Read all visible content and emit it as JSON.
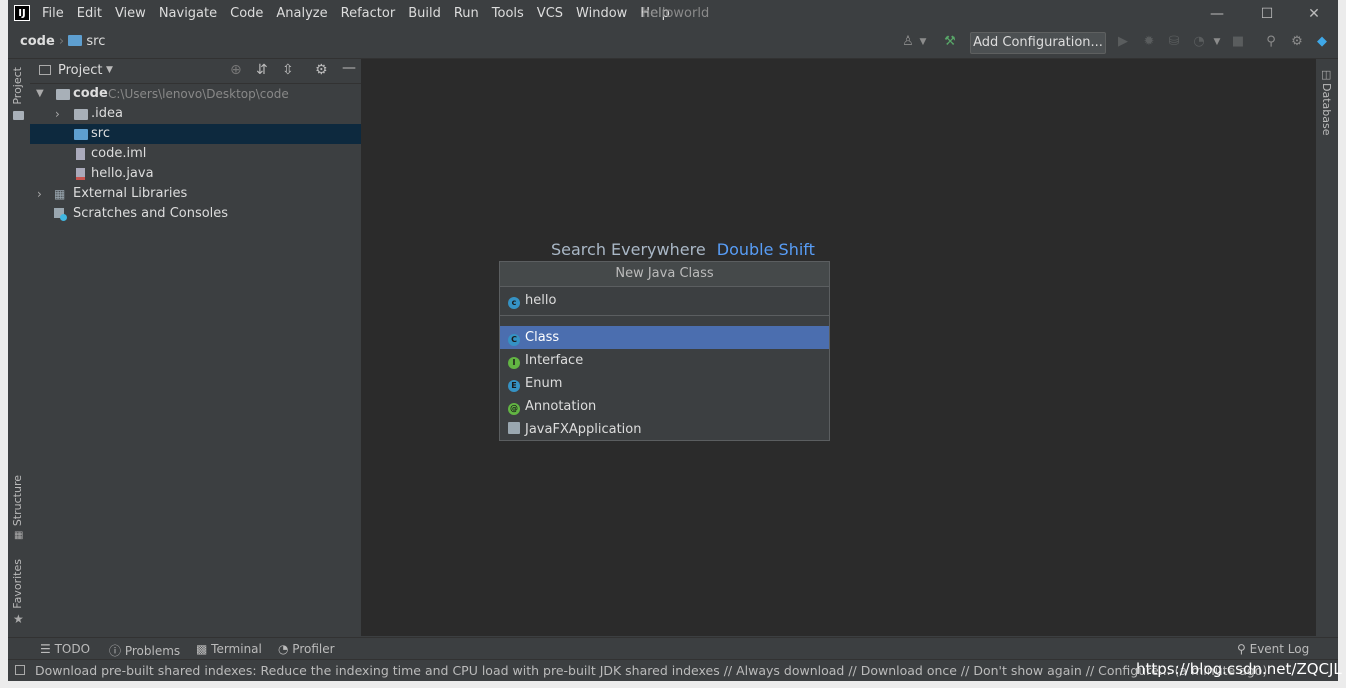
{
  "window": {
    "title": "helloworld",
    "app_logo": "IJ"
  },
  "menu": [
    "File",
    "Edit",
    "View",
    "Navigate",
    "Code",
    "Analyze",
    "Refactor",
    "Build",
    "Run",
    "Tools",
    "VCS",
    "Window",
    "Help"
  ],
  "breadcrumb": {
    "root": "code",
    "child": "src"
  },
  "toolbar": {
    "add_config": "Add Configuration..."
  },
  "left_tabs": {
    "project": "Project",
    "structure": "Structure",
    "favorites": "Favorites"
  },
  "right_tabs": {
    "database": "Database"
  },
  "project_panel": {
    "title": "Project"
  },
  "tree": [
    {
      "label": "code",
      "sub": "C:\\Users\\lenovo\\Desktop\\code"
    },
    {
      "label": ".idea"
    },
    {
      "label": "src"
    },
    {
      "label": "code.iml"
    },
    {
      "label": "hello.java"
    },
    {
      "label": "External Libraries"
    },
    {
      "label": "Scratches and Consoles"
    }
  ],
  "editor": {
    "hint": "Search Everywhere",
    "hint_key": "Double Shift"
  },
  "dialog": {
    "title": "New Java Class",
    "input_value": "hello",
    "kinds": [
      {
        "label": "Class",
        "badge": "C",
        "color": "#3592c4"
      },
      {
        "label": "Interface",
        "badge": "I",
        "color": "#62b543"
      },
      {
        "label": "Enum",
        "badge": "E",
        "color": "#3592c4"
      },
      {
        "label": "Annotation",
        "badge": "@",
        "color": "#62b543"
      },
      {
        "label": "JavaFXApplication",
        "badge": "",
        "color": "#9aa7b0"
      }
    ],
    "selected": "Class"
  },
  "bottom_tabs": [
    "TODO",
    "Problems",
    "Terminal",
    "Profiler"
  ],
  "event_log": "Event Log",
  "status": "Download pre-built shared indexes: Reduce the indexing time and CPU load with pre-built JDK shared indexes // Always download // Download once // Don't show again // Configure... (a minute ago)",
  "watermark": "https://blog.csdn.net/ZQCJL"
}
